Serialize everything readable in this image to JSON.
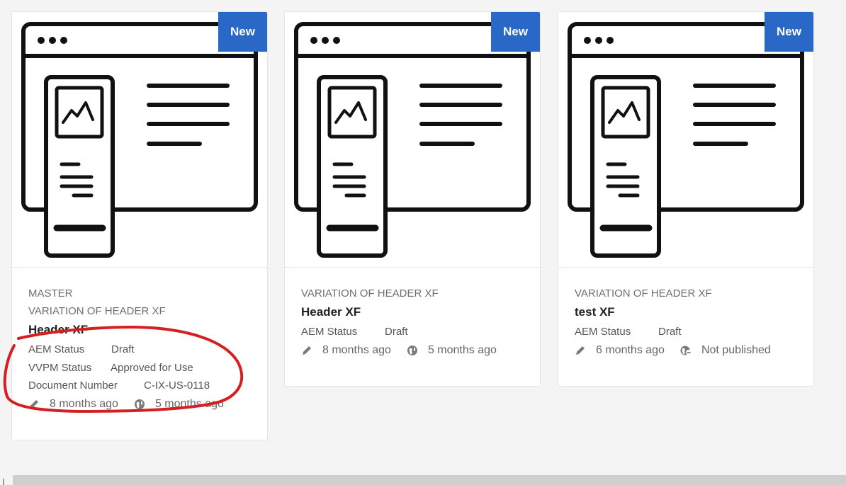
{
  "cards": [
    {
      "badge": "New",
      "eyebrow_lines": [
        "MASTER",
        "VARIATION OF HEADER XF"
      ],
      "title": "Header XF",
      "meta": [
        {
          "key": "AEM Status",
          "value": "Draft"
        },
        {
          "key": "VVPM Status",
          "value": "Approved for Use"
        },
        {
          "key": "Document Number",
          "value": "C-IX-US-0118"
        }
      ],
      "modified": "8 months ago",
      "published": "5 months ago",
      "publish_icon": "globe-icon"
    },
    {
      "badge": "New",
      "eyebrow_lines": [
        "VARIATION OF HEADER XF"
      ],
      "title": "Header XF",
      "meta": [
        {
          "key": "AEM Status",
          "value": "Draft"
        }
      ],
      "modified": "8 months ago",
      "published": "5 months ago",
      "publish_icon": "globe-icon"
    },
    {
      "badge": "New",
      "eyebrow_lines": [
        "VARIATION OF HEADER XF"
      ],
      "title": "test XF",
      "meta": [
        {
          "key": "AEM Status",
          "value": "Draft"
        }
      ],
      "modified": "6 months ago",
      "published": "Not published",
      "publish_icon": "globe-unpublished-icon"
    }
  ],
  "colors": {
    "badge": "#2a68c8",
    "annotation": "#d42020"
  }
}
